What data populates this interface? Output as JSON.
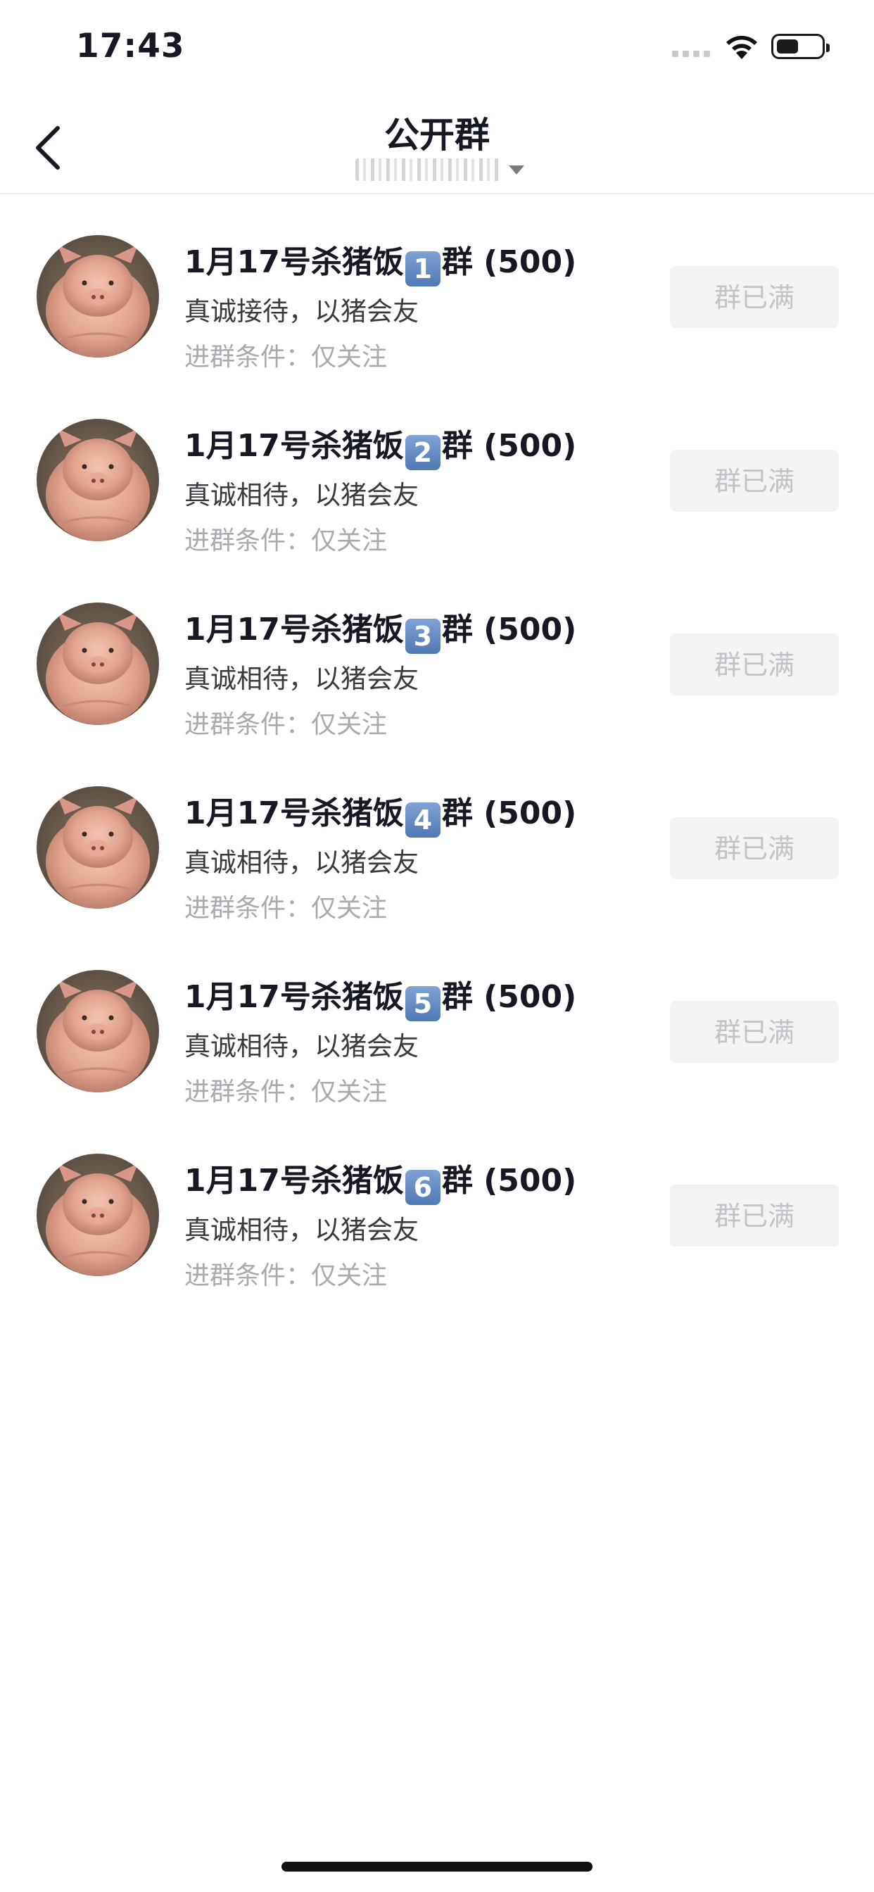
{
  "status_bar": {
    "time": "17:43"
  },
  "nav": {
    "title": "公开群",
    "back_icon": "chevron-left-icon",
    "dropdown_icon": "caret-down-icon"
  },
  "groups": [
    {
      "name_prefix": "1月17号杀猪饭",
      "number": "1",
      "name_suffix": "群 (500)",
      "description": "真诚接待，以猪会友",
      "condition": "进群条件：仅关注",
      "button": "群已满"
    },
    {
      "name_prefix": "1月17号杀猪饭",
      "number": "2",
      "name_suffix": "群 (500)",
      "description": "真诚相待，以猪会友",
      "condition": "进群条件：仅关注",
      "button": "群已满"
    },
    {
      "name_prefix": "1月17号杀猪饭",
      "number": "3",
      "name_suffix": "群 (500)",
      "description": "真诚相待，以猪会友",
      "condition": "进群条件：仅关注",
      "button": "群已满"
    },
    {
      "name_prefix": "1月17号杀猪饭",
      "number": "4",
      "name_suffix": "群 (500)",
      "description": "真诚相待，以猪会友",
      "condition": "进群条件：仅关注",
      "button": "群已满"
    },
    {
      "name_prefix": "1月17号杀猪饭",
      "number": "5",
      "name_suffix": "群 (500)",
      "description": "真诚相待，以猪会友",
      "condition": "进群条件：仅关注",
      "button": "群已满"
    },
    {
      "name_prefix": "1月17号杀猪饭",
      "number": "6",
      "name_suffix": "群 (500)",
      "description": "真诚相待，以猪会友",
      "condition": "进群条件：仅关注",
      "button": "群已满"
    }
  ],
  "colors": {
    "title": "#161823",
    "muted": "#a9aab0",
    "button_bg": "#f3f3f5",
    "keycap": "#5b84bd"
  }
}
